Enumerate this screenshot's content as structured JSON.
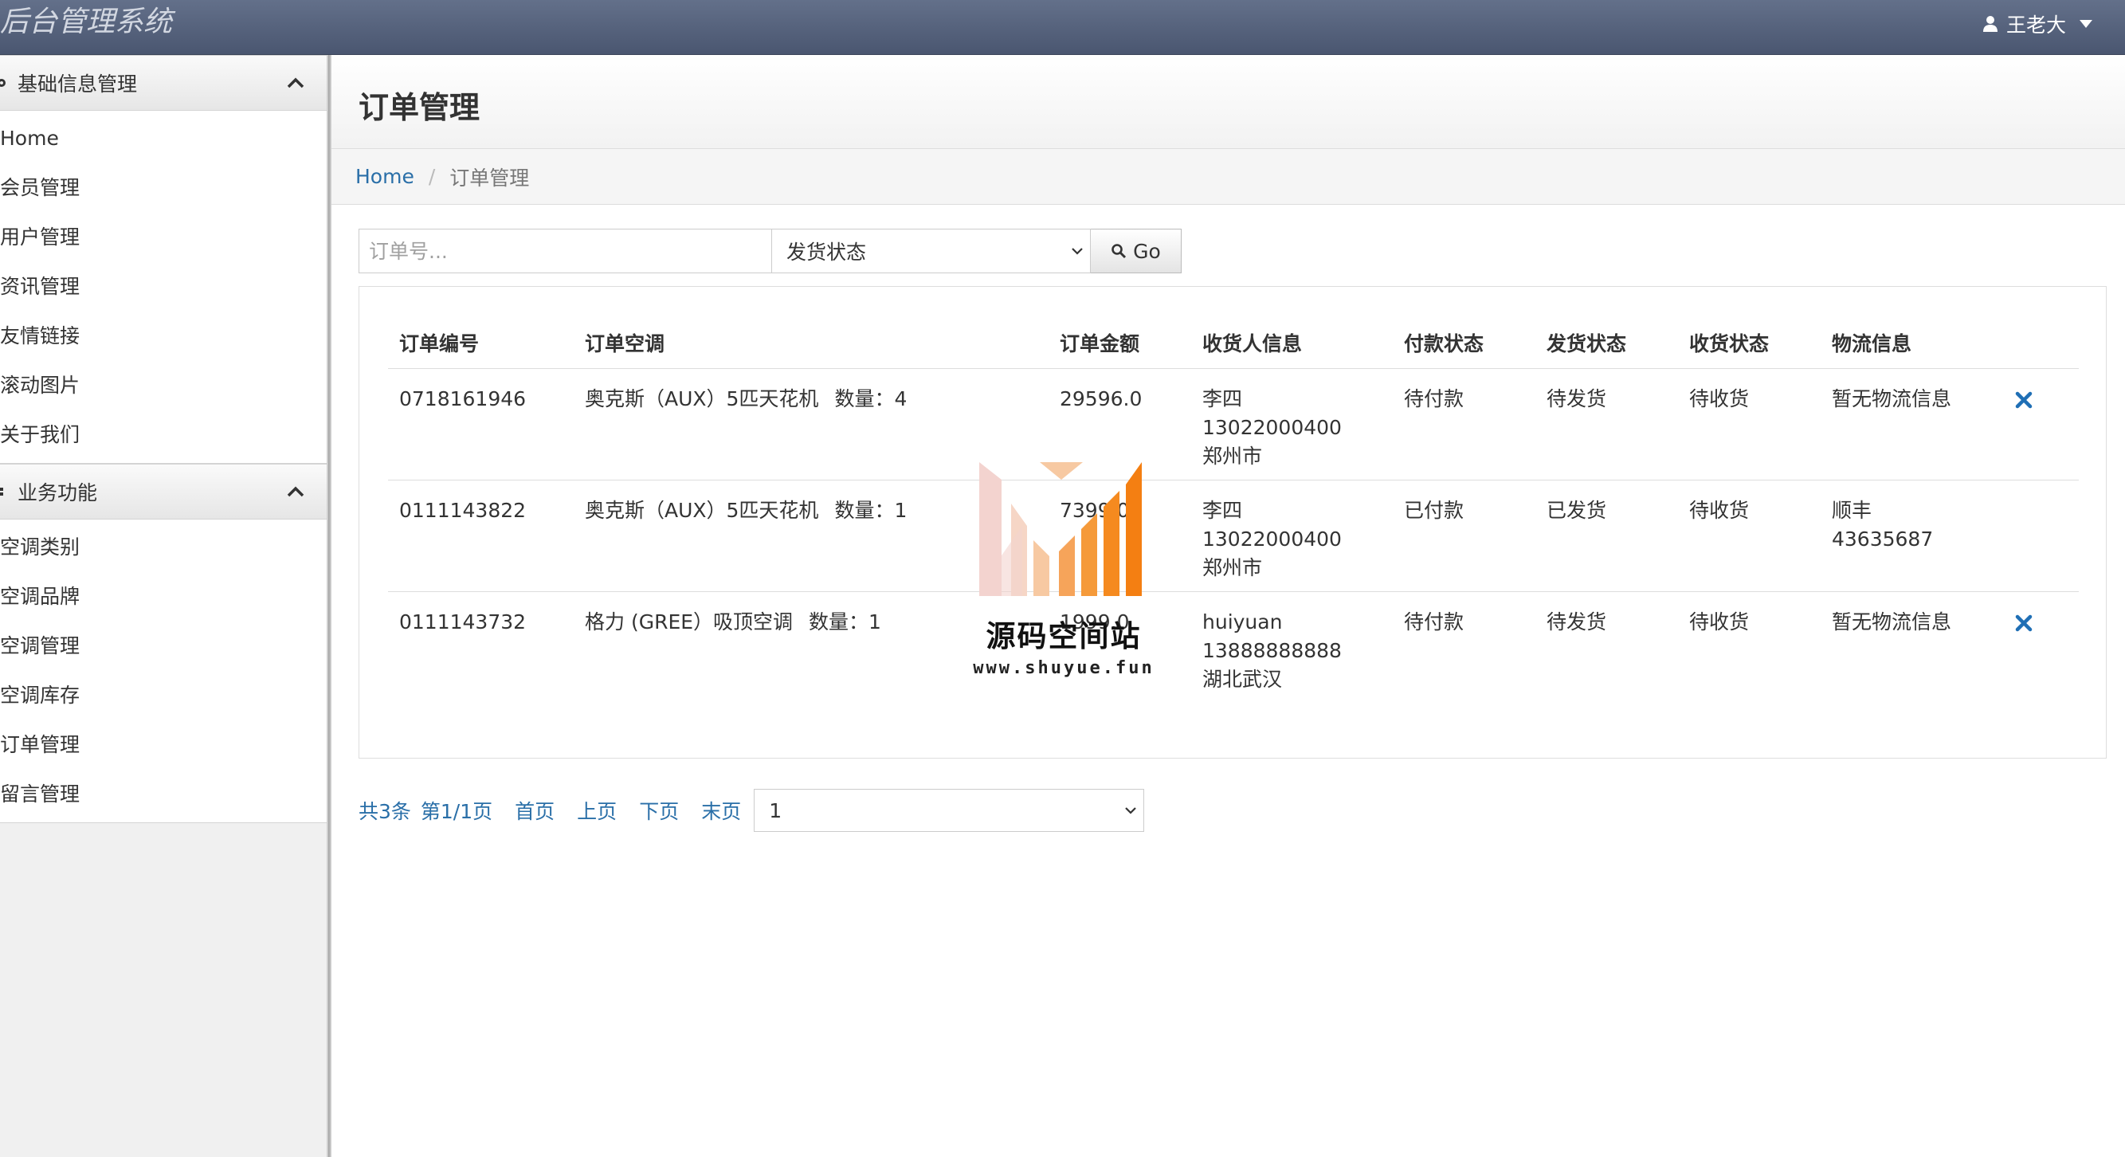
{
  "app": {
    "title": "后台管理系统",
    "user": "王老大"
  },
  "sidebar": {
    "groups": [
      {
        "title": "基础信息管理",
        "items": [
          "Home",
          "会员管理",
          "用户管理",
          "资讯管理",
          "友情链接",
          "滚动图片",
          "关于我们"
        ]
      },
      {
        "title": "业务功能",
        "items": [
          "空调类别",
          "空调品牌",
          "空调管理",
          "空调库存",
          "订单管理",
          "留言管理"
        ]
      }
    ]
  },
  "page": {
    "title": "订单管理",
    "breadcrumb": {
      "home": "Home",
      "separator": "/",
      "current": "订单管理"
    }
  },
  "search": {
    "placeholder": "订单号...",
    "status_select": "发货状态",
    "go_label": "Go"
  },
  "table": {
    "headers": [
      "订单编号",
      "订单空调",
      "订单金额",
      "收货人信息",
      "付款状态",
      "发货状态",
      "收货状态",
      "物流信息"
    ],
    "rows": [
      {
        "id": "0718161946",
        "goods": "奥克斯（AUX）5匹天花机",
        "qty": "数量：4",
        "amount": "29596.0",
        "receiver_name": "李四",
        "receiver_phone": "13022000400",
        "receiver_city": "郑州市",
        "pay_status": "待付款",
        "ship_status": "待发货",
        "receive_status": "待收货",
        "logistics_1": "暂无物流信息",
        "logistics_2": "",
        "deletable": true
      },
      {
        "id": "0111143822",
        "goods": "奥克斯（AUX）5匹天花机",
        "qty": "数量：1",
        "amount": "7399.0",
        "receiver_name": "李四",
        "receiver_phone": "13022000400",
        "receiver_city": "郑州市",
        "pay_status": "已付款",
        "ship_status": "已发货",
        "receive_status": "待收货",
        "logistics_1": "顺丰",
        "logistics_2": "43635687",
        "deletable": false
      },
      {
        "id": "0111143732",
        "goods": "格力 (GREE）吸顶空调",
        "qty": "数量：1",
        "amount": "1999.0",
        "receiver_name": "huiyuan",
        "receiver_phone": "13888888888",
        "receiver_city": "湖北武汉",
        "pay_status": "待付款",
        "ship_status": "待发货",
        "receive_status": "待收货",
        "logistics_1": "暂无物流信息",
        "logistics_2": "",
        "deletable": true
      }
    ]
  },
  "pagination": {
    "total": "共3条",
    "page_info": "第1/1页",
    "first": "首页",
    "prev": "上页",
    "next": "下页",
    "last": "末页",
    "page_select": "1"
  },
  "watermark": {
    "title": "源码空间站",
    "url": "www.shuyue.fun"
  },
  "colors": {
    "topbar": "#55627c",
    "link": "#2a6fa8",
    "delete": "#1f6fb5",
    "watermark_orange": "#f58a1f"
  },
  "icons": {
    "user": "user-icon",
    "caret": "caret-down-icon",
    "collapse": "chevron-up-icon",
    "search": "search-icon",
    "delete": "close-icon"
  }
}
